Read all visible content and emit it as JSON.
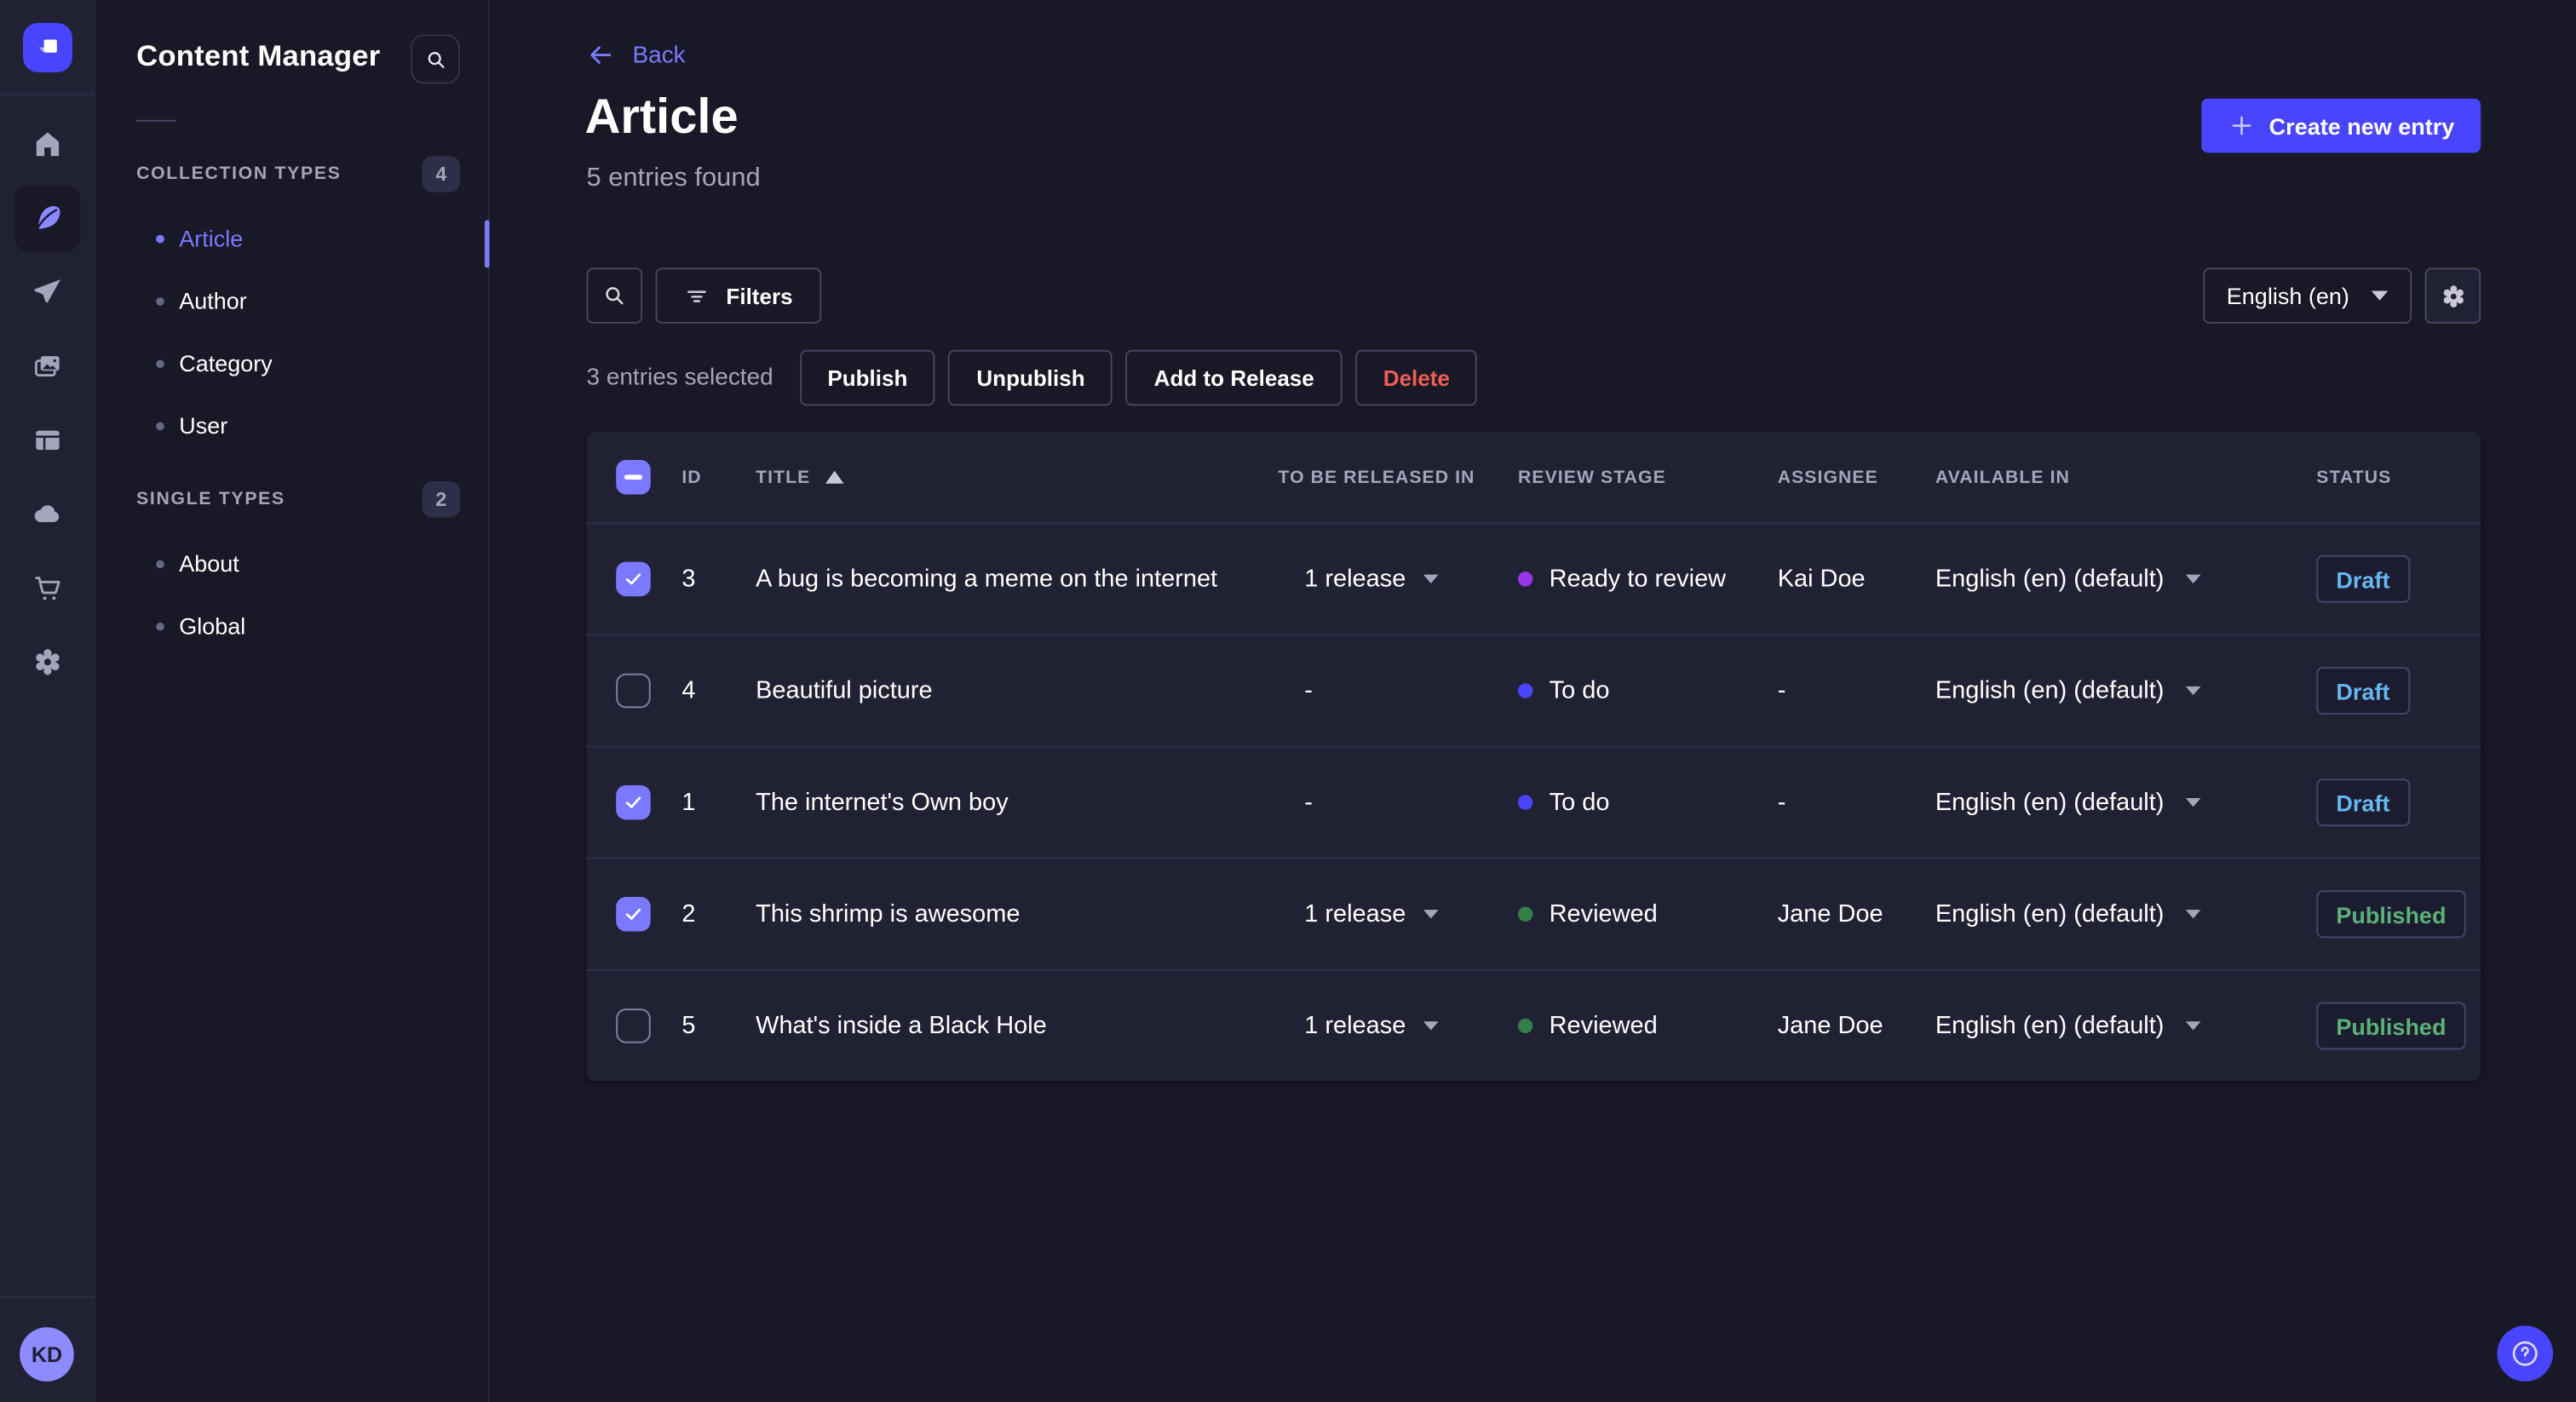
{
  "colors": {
    "page_bg": "#181826",
    "surface_bg": "#212134",
    "primary": "#4945ff",
    "accent": "#7b79ff",
    "text_muted": "#a5a5ba",
    "draft": "#66b7f1",
    "published": "#5cb176",
    "danger": "#ee5e52",
    "stage_todo": "#4945ff",
    "stage_ready_to_review": "#9736e8",
    "stage_reviewed": "#328048"
  },
  "rail": {
    "icons": [
      "home",
      "feather",
      "paper-plane",
      "images",
      "layout",
      "cloud",
      "cart",
      "gear"
    ],
    "avatar_initials": "KD"
  },
  "panel": {
    "title": "Content Manager",
    "search_icon": "search-icon",
    "sections": [
      {
        "label": "COLLECTION TYPES",
        "count": "4",
        "items": [
          {
            "label": "Article"
          },
          {
            "label": "Author"
          },
          {
            "label": "Category"
          },
          {
            "label": "User"
          }
        ]
      },
      {
        "label": "SINGLE TYPES",
        "count": "2",
        "items": [
          {
            "label": "About"
          },
          {
            "label": "Global"
          }
        ]
      }
    ]
  },
  "header": {
    "back_label": "Back",
    "title": "Article",
    "subtitle": "5 entries found",
    "create_button_label": "Create new entry"
  },
  "toolbar": {
    "filters_label": "Filters",
    "locale_value": "English (en)"
  },
  "selection": {
    "text": "3 entries selected",
    "actions": [
      "Publish",
      "Unpublish",
      "Add to Release",
      "Delete"
    ]
  },
  "table": {
    "headers": [
      "ID",
      "TITLE",
      "TO BE RELEASED IN",
      "REVIEW STAGE",
      "ASSIGNEE",
      "AVAILABLE IN",
      "STATUS"
    ],
    "sorted_by": "TITLE",
    "sort_direction": "ascending",
    "rows": [
      {
        "checked": true,
        "id": "3",
        "title": "A bug is becoming a meme on the internet",
        "release": "1 release",
        "stage": "Ready to review",
        "stage_color": "#9736e8",
        "assignee": "Kai Doe",
        "locale": "English (en) (default)",
        "status": "Draft"
      },
      {
        "checked": false,
        "id": "4",
        "title": "Beautiful picture",
        "release": "-",
        "stage": "To do",
        "stage_color": "#4945ff",
        "assignee": "-",
        "locale": "English (en) (default)",
        "status": "Draft"
      },
      {
        "checked": true,
        "id": "1",
        "title": "The internet's Own boy",
        "release": "-",
        "stage": "To do",
        "stage_color": "#4945ff",
        "assignee": "-",
        "locale": "English (en) (default)",
        "status": "Draft"
      },
      {
        "checked": true,
        "id": "2",
        "title": "This shrimp is awesome",
        "release": "1 release",
        "stage": "Reviewed",
        "stage_color": "#328048",
        "assignee": "Jane Doe",
        "locale": "English (en) (default)",
        "status": "Published"
      },
      {
        "checked": false,
        "id": "5",
        "title": "What's inside a Black Hole",
        "release": "1 release",
        "stage": "Reviewed",
        "stage_color": "#328048",
        "assignee": "Jane Doe",
        "locale": "English (en) (default)",
        "status": "Published"
      }
    ]
  },
  "avatar": {
    "initials": "KD"
  }
}
